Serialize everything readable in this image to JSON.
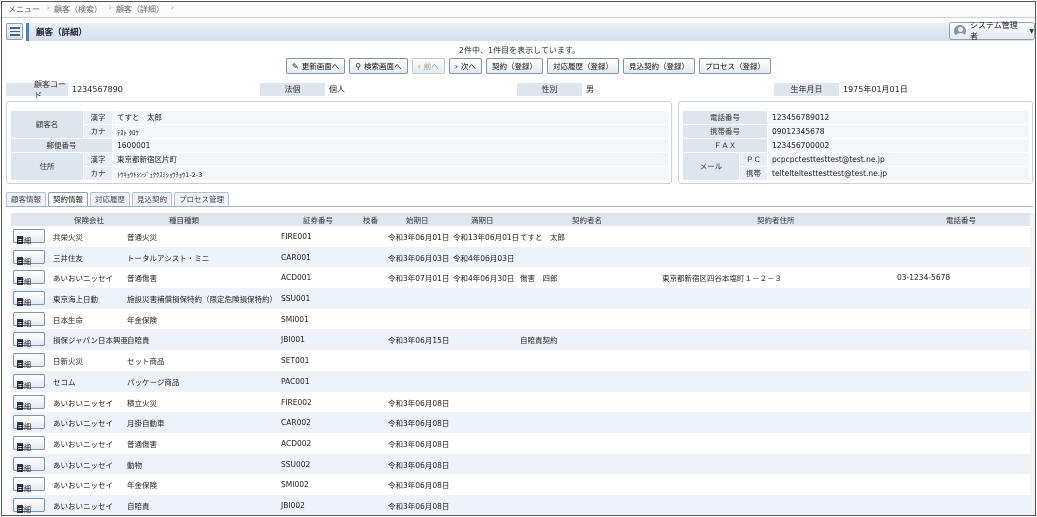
{
  "breadcrumb": [
    "メニュー",
    "顧客（検索）",
    "顧客（詳細）"
  ],
  "header": {
    "title": "顧客（詳細）",
    "user": "システム管理者"
  },
  "record_info": "2件中、1件目を表示しています。",
  "toolbar": {
    "update": "更新画面へ",
    "search": "検索画面へ",
    "prev": "前へ",
    "next": "次へ",
    "contract": "契約（登録）",
    "history": "対応履歴（登録）",
    "prospect": "見込契約（登録）",
    "process": "プロセス（登録）"
  },
  "summary": {
    "code_label": "顧客コード",
    "code": "1234567890",
    "corp_label": "法個",
    "corp": "個人",
    "sex_label": "性別",
    "sex": "男",
    "birth_label": "生年月日",
    "birth": "1975年01月01日"
  },
  "left_panel": {
    "name_label": "顧客名",
    "kanji_label": "漢字",
    "name_kanji": "てすと　太郎",
    "kana_label": "カナ",
    "name_kana": "ﾃｽﾄ ﾀﾛｳ",
    "zip_label": "郵便番号",
    "zip": "1600001",
    "addr_label": "住所",
    "addr_kanji_label": "漢字",
    "addr_kanji": "東京都新宿区片町",
    "addr_kana_label": "カナ",
    "addr_kana": "ﾄｳｷｮｳﾄｼﾝｼﾞｭｸｸｽﾐｼｮｳﾁｮｳ1-2-3"
  },
  "right_panel": {
    "tel_label": "電話番号",
    "tel": "123456789012",
    "mobile_label": "携帯番号",
    "mobile": "09012345678",
    "fax_label": "ＦＡＸ",
    "fax": "123456700002",
    "mail_label": "メール",
    "pc_label": "ＰＣ",
    "pc": "pcpcpctesttesttest@test.ne.jp",
    "mobile_mail_label": "携帯",
    "mobile_mail": "teltelteltesttesttest@test.ne.jp"
  },
  "tabs": [
    "顧客情報",
    "契約情報",
    "対応履歴",
    "見込契約",
    "プロセス管理"
  ],
  "active_tab": 1,
  "grid": {
    "detail_label": "詳細",
    "headers": {
      "insurer": "保険会社",
      "kind": "種目種類",
      "policy": "証券番号",
      "branch": "枝番",
      "start": "始期日",
      "end": "満期日",
      "holder": "契約者名",
      "holder_addr": "契約者住所",
      "tel": "電話番号"
    },
    "rows": [
      {
        "insurer": "共栄火災",
        "kind": "普通火災",
        "policy": "FIRE001",
        "start": "令和3年06月01日",
        "end": "令和13年06月01日",
        "holder": "てすと　太郎",
        "holder_addr": "",
        "tel": ""
      },
      {
        "insurer": "三井住友",
        "kind": "トータルアシスト・ミニ",
        "policy": "CAR001",
        "start": "令和3年06月03日",
        "end": "令和4年06月03日",
        "holder": "",
        "holder_addr": "",
        "tel": ""
      },
      {
        "insurer": "あいおいニッセイ",
        "kind": "普通傷害",
        "policy": "ACD001",
        "start": "令和3年07月01日",
        "end": "令和4年06月30日",
        "holder": "傷害　四郎",
        "holder_addr": "東京都新宿区四谷本塩町１－２－３",
        "tel": "03-1234-5678"
      },
      {
        "insurer": "東京海上日動",
        "kind": "施設災害補償損保特約（限定危険損保特約）",
        "policy": "SSU001",
        "start": "",
        "end": "",
        "holder": "",
        "holder_addr": "",
        "tel": ""
      },
      {
        "insurer": "日本生命",
        "kind": "年金保険",
        "policy": "SMI001",
        "start": "",
        "end": "",
        "holder": "",
        "holder_addr": "",
        "tel": ""
      },
      {
        "insurer": "損保ジャパン日本興亜",
        "kind": "自賠責",
        "policy": "JBI001",
        "start": "令和3年06月15日",
        "end": "",
        "holder": "自賠責契約",
        "holder_addr": "",
        "tel": ""
      },
      {
        "insurer": "日新火災",
        "kind": "セット商品",
        "policy": "SET001",
        "start": "",
        "end": "",
        "holder": "",
        "holder_addr": "",
        "tel": ""
      },
      {
        "insurer": "セコム",
        "kind": "パッケージ商品",
        "policy": "PAC001",
        "start": "",
        "end": "",
        "holder": "",
        "holder_addr": "",
        "tel": ""
      },
      {
        "insurer": "あいおいニッセイ",
        "kind": "積立火災",
        "policy": "FIRE002",
        "start": "令和3年06月08日",
        "end": "",
        "holder": "",
        "holder_addr": "",
        "tel": ""
      },
      {
        "insurer": "あいおいニッセイ",
        "kind": "月掛自動車",
        "policy": "CAR002",
        "start": "令和3年06月08日",
        "end": "",
        "holder": "",
        "holder_addr": "",
        "tel": ""
      },
      {
        "insurer": "あいおいニッセイ",
        "kind": "普通傷害",
        "policy": "ACD002",
        "start": "令和3年06月08日",
        "end": "",
        "holder": "",
        "holder_addr": "",
        "tel": ""
      },
      {
        "insurer": "あいおいニッセイ",
        "kind": "動物",
        "policy": "SSU002",
        "start": "令和3年06月08日",
        "end": "",
        "holder": "",
        "holder_addr": "",
        "tel": ""
      },
      {
        "insurer": "あいおいニッセイ",
        "kind": "年金保険",
        "policy": "SMI002",
        "start": "令和3年06月08日",
        "end": "",
        "holder": "",
        "holder_addr": "",
        "tel": ""
      },
      {
        "insurer": "あいおいニッセイ",
        "kind": "自賠責",
        "policy": "JBI002",
        "start": "令和3年06月08日",
        "end": "",
        "holder": "",
        "holder_addr": "",
        "tel": ""
      }
    ]
  }
}
